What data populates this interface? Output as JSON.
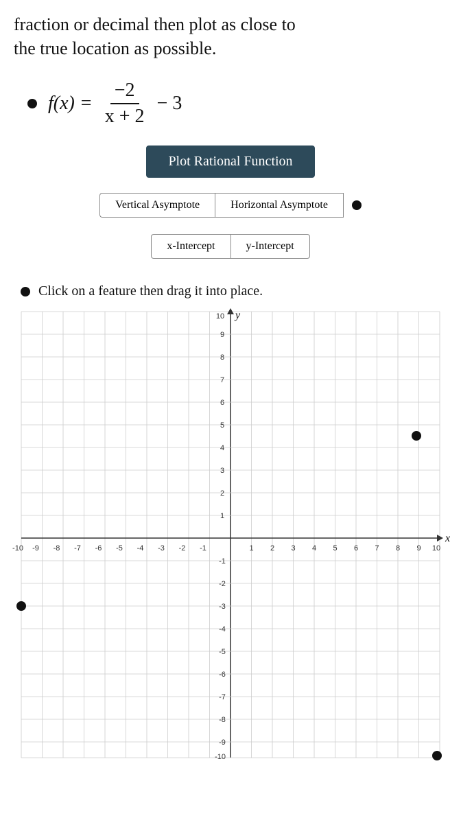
{
  "top_text_line1": "fraction or decimal then plot as close to",
  "top_text_line2": "the true location as possible.",
  "formula": {
    "lhs": "f(x) =",
    "numerator": "−2",
    "denominator": "x + 2",
    "rhs": "− 3"
  },
  "plot_button_label": "Plot Rational Function",
  "asymptote_buttons": {
    "vertical": "Vertical Asymptote",
    "horizontal": "Horizontal Asymptote"
  },
  "intercept_buttons": {
    "x": "x-Intercept",
    "y": "y-Intercept"
  },
  "click_instruction": "Click on a feature then drag it into place.",
  "graph": {
    "x_min": -10,
    "x_max": 10,
    "y_min": -10,
    "y_max": 10,
    "x_label": "x",
    "y_label": "y"
  },
  "dots": [
    {
      "label": "dot-top-right",
      "cx_grid": 9,
      "cy_grid": 4.5
    },
    {
      "label": "dot-bottom-left",
      "cx_grid": -10,
      "cy_grid": -3
    },
    {
      "label": "dot-bottom-right",
      "cx_grid": 10,
      "cy_grid": -10
    }
  ]
}
